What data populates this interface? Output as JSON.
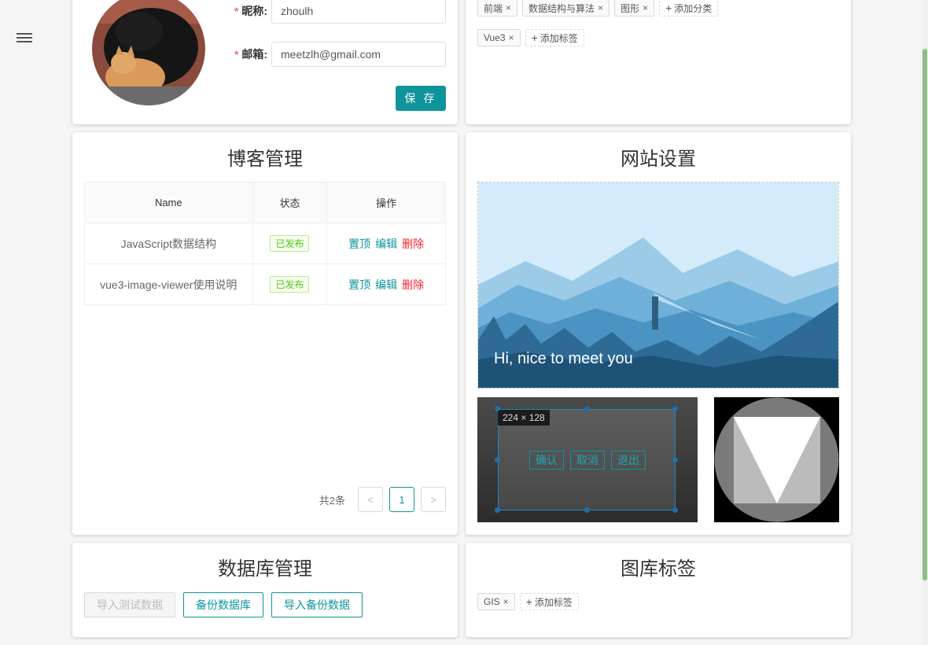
{
  "profile": {
    "nickname_label": "昵称:",
    "nickname_value": "zhoulh",
    "email_label": "邮箱:",
    "email_value": "meetzlh@gmail.com",
    "required_mark": "*",
    "save_label": "保 存"
  },
  "tags_card": {
    "categories": [
      "前端",
      "数据结构与算法",
      "图形"
    ],
    "add_category_label": "添加分类",
    "tags": [
      "Vue3"
    ],
    "add_tag_label": "添加标签",
    "close_glyph": "×",
    "plus_glyph": "+"
  },
  "blog": {
    "title": "博客管理",
    "columns": [
      "Name",
      "状态",
      "操作"
    ],
    "rows": [
      {
        "name": "JavaScript数据结构",
        "status": "已发布"
      },
      {
        "name": "vue3-image-viewer使用说明",
        "status": "已发布"
      }
    ],
    "actions": {
      "pin": "置顶",
      "edit": "编辑",
      "delete": "删除"
    },
    "pagination": {
      "total_text": "共2条",
      "current_page": "1",
      "prev": "<",
      "next": ">"
    }
  },
  "site": {
    "title": "网站设置",
    "banner_text": "Hi, nice to meet you",
    "crop_size": "224 × 128",
    "crop_confirm": "确认",
    "crop_cancel": "取消",
    "crop_exit": "退出"
  },
  "database": {
    "title": "数据库管理",
    "import_test_label": "导入测试数据",
    "backup_label": "备份数据库",
    "import_backup_label": "导入备份数据"
  },
  "gallery": {
    "title": "图库标签",
    "tags": [
      "GIS"
    ],
    "add_tag_label": "添加标签"
  },
  "colors": {
    "accent": "#0f949c",
    "danger": "#f5222d",
    "success": "#52c41a",
    "scrollbar": "#8fbf88"
  }
}
